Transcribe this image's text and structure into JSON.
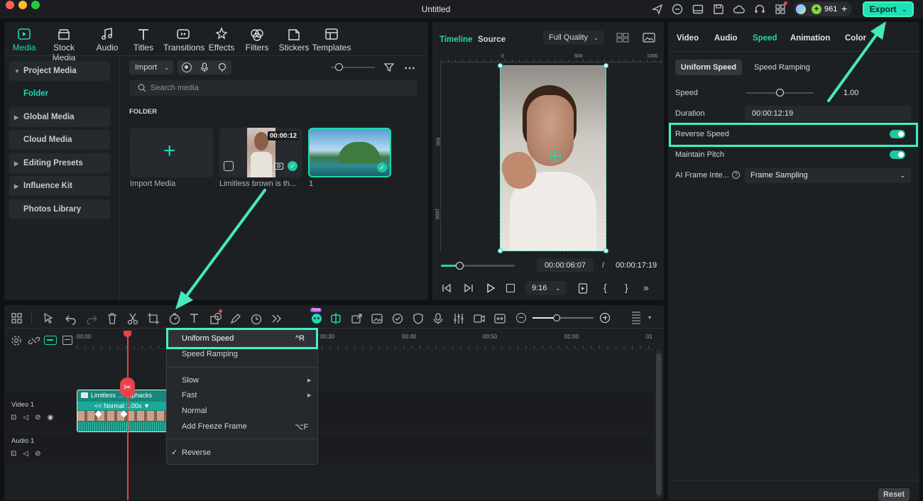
{
  "window": {
    "title": "Untitled",
    "credits": "961",
    "export_label": "Export"
  },
  "media_tabs": [
    {
      "label": "Media",
      "icon": "media-icon"
    },
    {
      "label": "Stock Media",
      "icon": "stock-media-icon"
    },
    {
      "label": "Audio",
      "icon": "audio-icon"
    },
    {
      "label": "Titles",
      "icon": "titles-icon"
    },
    {
      "label": "Transitions",
      "icon": "transitions-icon"
    },
    {
      "label": "Effects",
      "icon": "effects-icon"
    },
    {
      "label": "Filters",
      "icon": "filters-icon"
    },
    {
      "label": "Stickers",
      "icon": "stickers-icon"
    },
    {
      "label": "Templates",
      "icon": "templates-icon"
    }
  ],
  "sidebar": {
    "items": [
      "Project Media",
      "Folder",
      "Global Media",
      "Cloud Media",
      "Editing Presets",
      "Influence Kit",
      "Photos Library"
    ]
  },
  "media": {
    "import_label": "Import",
    "search_placeholder": "Search media",
    "folder_heading": "FOLDER",
    "import_card_label": "Import Media",
    "clip1_label": "Limitless brown is th...",
    "clip1_duration": "00:00:12",
    "clip2_label": "1"
  },
  "preview": {
    "tab_timeline": "Timeline",
    "tab_source": "Source",
    "quality": "Full Quality",
    "ruler_top": [
      "0",
      "500",
      "1000"
    ],
    "ruler_left": [
      "500",
      "1000"
    ],
    "current_time": "00:00:06:07",
    "separator": "/",
    "total_time": "00:00:17:19",
    "aspect": "9:16",
    "progress": 0.25
  },
  "right_panel": {
    "tabs": [
      "Video",
      "Audio",
      "Speed",
      "Animation",
      "Color"
    ],
    "subtabs": [
      "Uniform Speed",
      "Speed Ramping"
    ],
    "speed_label": "Speed",
    "speed_value": "1.00",
    "duration_label": "Duration",
    "duration_value": "00:00:12:19",
    "reverse_label": "Reverse Speed",
    "pitch_label": "Maintain Pitch",
    "ai_label": "AI Frame Inte...",
    "ai_value": "Frame Sampling",
    "reset_label": "Reset"
  },
  "timeline": {
    "ruler": [
      "00:00",
      "00:30",
      "00:40",
      "00:50",
      "01:00",
      "01"
    ],
    "video_track": "Video 1",
    "audio_track": "Audio 1",
    "clip_title": "Limitless ... euphacks",
    "clip_speed": "<< Normal 1.00x",
    "new_badge": "New"
  },
  "speed_menu": {
    "items": [
      {
        "label": "Uniform Speed",
        "shortcut": "^R"
      },
      {
        "label": "Speed Ramping",
        "shortcut": ""
      },
      {
        "label": "Slow",
        "shortcut": ""
      },
      {
        "label": "Fast",
        "shortcut": ""
      },
      {
        "label": "Normal",
        "shortcut": ""
      },
      {
        "label": "Add Freeze Frame",
        "shortcut": "⌥F"
      },
      {
        "label": "Reverse",
        "shortcut": ""
      }
    ]
  },
  "colors": {
    "accent": "#1fd7b0",
    "highlight_box": "#3ef2c4",
    "playhead": "#e8434a"
  }
}
